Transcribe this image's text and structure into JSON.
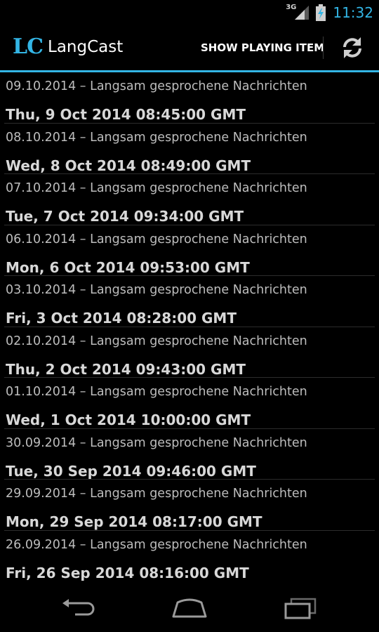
{
  "status_bar": {
    "network_type": "3G",
    "time": "11:32"
  },
  "action_bar": {
    "logo_text": "LC",
    "app_title": "LangCast",
    "show_playing_label": "SHOW PLAYING ITEM",
    "refresh_icon": "refresh-icon"
  },
  "episodes": [
    {
      "title": "09.10.2014 – Langsam gesprochene Nachrichten",
      "date": "Thu, 9 Oct 2014 08:45:00 GMT"
    },
    {
      "title": "08.10.2014 – Langsam gesprochene Nachrichten",
      "date": "Wed, 8 Oct 2014 08:49:00 GMT"
    },
    {
      "title": "07.10.2014 – Langsam gesprochene Nachrichten",
      "date": "Tue, 7 Oct 2014 09:34:00 GMT"
    },
    {
      "title": "06.10.2014 – Langsam gesprochene Nachrichten",
      "date": "Mon, 6 Oct 2014 09:53:00 GMT"
    },
    {
      "title": "03.10.2014 – Langsam gesprochene Nachrichten",
      "date": "Fri, 3 Oct 2014 08:28:00 GMT"
    },
    {
      "title": "02.10.2014 – Langsam gesprochene Nachrichten",
      "date": "Thu, 2 Oct 2014 09:43:00 GMT"
    },
    {
      "title": "01.10.2014 – Langsam gesprochene Nachrichten",
      "date": "Wed, 1 Oct 2014 10:00:00 GMT"
    },
    {
      "title": "30.09.2014 – Langsam gesprochene Nachrichten",
      "date": "Tue, 30 Sep 2014 09:46:00 GMT"
    },
    {
      "title": "29.09.2014 – Langsam gesprochene Nachrichten",
      "date": "Mon, 29 Sep 2014 08:17:00 GMT"
    },
    {
      "title": "26.09.2014 – Langsam gesprochene Nachrichten",
      "date": "Fri, 26 Sep 2014 08:16:00 GMT"
    }
  ],
  "colors": {
    "accent": "#33b5e5",
    "background": "#000000"
  }
}
